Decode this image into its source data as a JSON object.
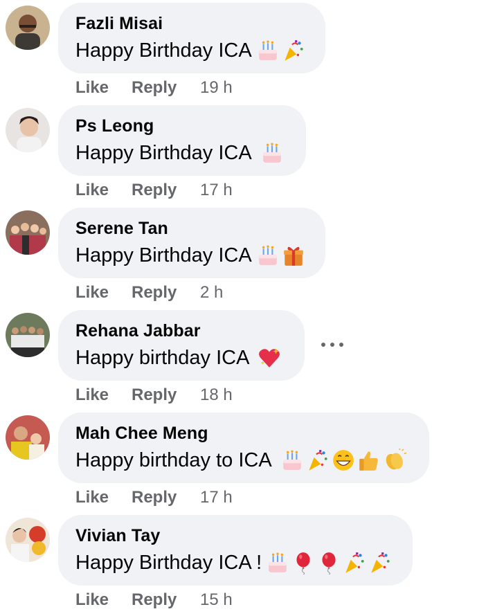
{
  "comments": [
    {
      "author": "Fazli Misai",
      "text": "Happy Birthday ICA",
      "like": "Like",
      "reply": "Reply",
      "time": "19 h",
      "emojis": [
        "birthday-cake",
        "party-popper"
      ]
    },
    {
      "author": "Ps Leong",
      "text": "Happy Birthday ICA",
      "like": "Like",
      "reply": "Reply",
      "time": "17 h",
      "emojis": [
        "birthday-cake"
      ]
    },
    {
      "author": "Serene Tan",
      "text": "Happy Birthday ICA",
      "like": "Like",
      "reply": "Reply",
      "time": "2 h",
      "emojis": [
        "birthday-cake",
        "wrapped-gift"
      ]
    },
    {
      "author": "Rehana Jabbar",
      "text": "Happy birthday ICA",
      "like": "Like",
      "reply": "Reply",
      "time": "18 h",
      "emojis": [
        "sparkling-heart"
      ]
    },
    {
      "author": "Mah Chee Meng",
      "text": "Happy birthday to ICA",
      "like": "Like",
      "reply": "Reply",
      "time": "17 h",
      "emojis": [
        "birthday-cake",
        "party-popper",
        "grinning-face",
        "thumbs-up",
        "clapping-hands"
      ]
    },
    {
      "author": "Vivian Tay",
      "text": "Happy Birthday ICA !",
      "like": "Like",
      "reply": "Reply",
      "time": "15 h",
      "emojis": [
        "birthday-cake",
        "balloon",
        "balloon",
        "party-popper",
        "party-popper"
      ]
    }
  ],
  "colors": {
    "bubble": "#f0f2f5",
    "meta": "#65676b",
    "text": "#050505"
  }
}
